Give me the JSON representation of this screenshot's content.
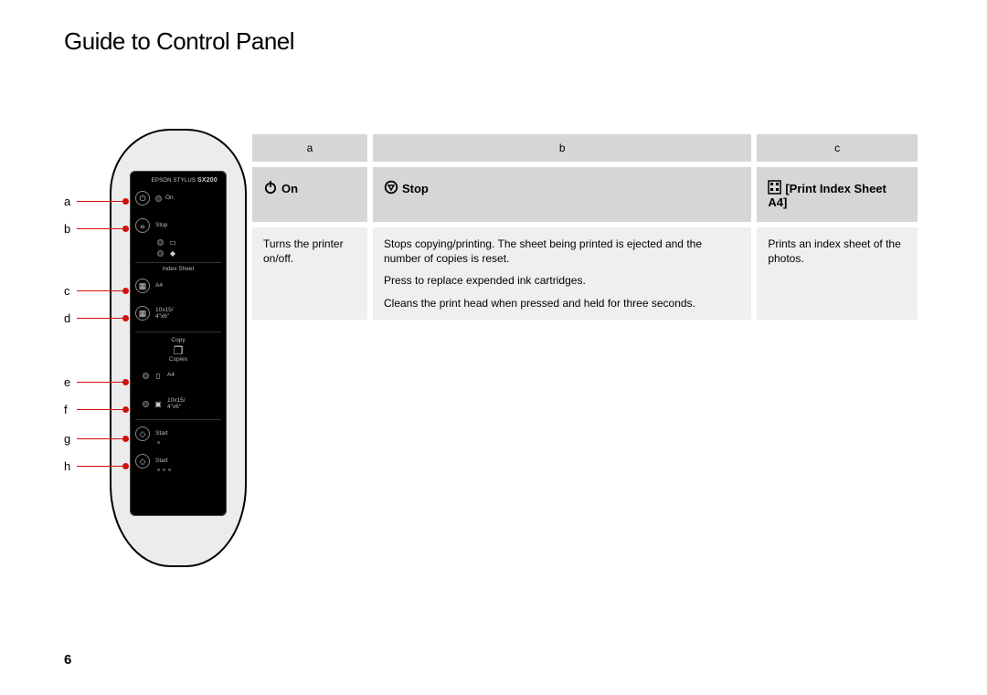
{
  "page": {
    "title": "Guide to Control Panel",
    "number": "6"
  },
  "callouts": [
    "a",
    "b",
    "c",
    "d",
    "e",
    "f",
    "g",
    "h"
  ],
  "panel": {
    "brand_prefix": "EPSON STYLUS",
    "brand_model": "SX200",
    "rows": {
      "on": "On",
      "stop": "Stop",
      "index_sheet": "Index Sheet",
      "a4": "A4",
      "size_small": "10x15/\n4\"x6\"",
      "copy": "Copy",
      "copies": "Copies",
      "a4_2": "A4",
      "size_small_2": "10x15/\n4\"x6\"",
      "start1": "Start",
      "start2": "Start"
    }
  },
  "table": {
    "headers": [
      "a",
      "b",
      "c"
    ],
    "icon_labels": {
      "a": "On",
      "b": "Stop",
      "c": "Print Index Sheet A4"
    },
    "descriptions": {
      "a": [
        "Turns the printer on/off."
      ],
      "b": [
        "Stops copying/printing. The sheet being printed is ejected and the number of copies is reset.",
        "Press to replace expended ink cartridges.",
        "Cleans the print head when pressed and held for three seconds."
      ],
      "c": [
        "Prints an index sheet of the photos."
      ]
    }
  }
}
